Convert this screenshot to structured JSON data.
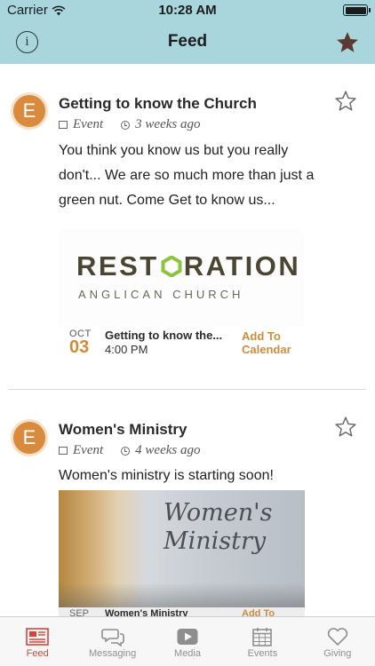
{
  "status_bar": {
    "carrier": "Carrier",
    "time": "10:28 AM"
  },
  "nav": {
    "title": "Feed",
    "info_icon": "info-icon",
    "favorites_icon": "star-filled-icon"
  },
  "posts": [
    {
      "avatar_letter": "E",
      "title": "Getting to know the Church",
      "type": "Event",
      "age": "3 weeks ago",
      "body": "You think you know us but you really don't... We are so much more than just a green nut. Come Get to know us...",
      "image": {
        "logo_pre": "REST",
        "logo_post": "RATION",
        "logo_sub": "ANGLICAN CHURCH"
      },
      "event": {
        "month": "OCT",
        "day": "03",
        "title": "Getting to know the...",
        "time": "4:00 PM",
        "calendar_line1": "Add To",
        "calendar_line2": "Calendar"
      }
    },
    {
      "avatar_letter": "E",
      "title": "Women's Ministry",
      "type": "Event",
      "age": "4 weeks ago",
      "body": "Women's ministry is starting soon!",
      "image": {
        "line1": "Women's",
        "line2": "Ministry"
      },
      "event": {
        "month": "SEP",
        "title": "Women's Ministry",
        "calendar_line1": "Add To"
      }
    }
  ],
  "tabs": [
    {
      "label": "Feed",
      "icon": "newspaper-icon",
      "active": true
    },
    {
      "label": "Messaging",
      "icon": "chat-bubbles-icon",
      "active": false
    },
    {
      "label": "Media",
      "icon": "play-icon",
      "active": false
    },
    {
      "label": "Events",
      "icon": "calendar-icon",
      "active": false
    },
    {
      "label": "Giving",
      "icon": "heart-icon",
      "active": false
    }
  ],
  "colors": {
    "nav_bg": "#a9d5dd",
    "accent": "#d08a3a",
    "tab_active": "#d6453a",
    "logo_green": "#8cc43f"
  }
}
